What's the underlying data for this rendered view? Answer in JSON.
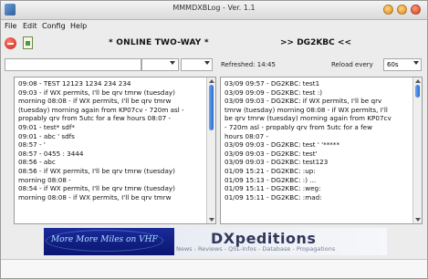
{
  "window": {
    "title": "MMMDXBLog - Ver. 1.1"
  },
  "menu": {
    "items": [
      "File",
      "Edit",
      "Config",
      "Help"
    ]
  },
  "toolbar": {
    "status": "* ONLINE  TWO-WAY *",
    "target": ">> DG2KBC <<"
  },
  "filter": {
    "refreshed": "Refreshed: 14:45",
    "reload_label": "Reload every",
    "reload_value": "60s"
  },
  "left_log": {
    "lines": [
      "09:08 - TEST 12123 1234 234 234",
      "09:03 - if WX permits, I'll be qrv tmrw (tuesday)",
      "morning 08:08 - if WX permits, I'll be qrv tmrw",
      "(tuesday) morning again from KP07cv - 720m asl -",
      "propably qrv from 5utc for a few hours 08:07 -",
      "09:01 - test* sdf*",
      "09:01 - abc ' sdfs",
      "08:57 - '",
      "08:57 - 0455 : 3444",
      "08:56 - abc",
      "08:56 - if WX permits, I'll be qrv tmrw (tuesday)",
      "morning 08:08 -",
      "08:54 - if WX permits, I'll be qrv tmrw (tuesday)",
      "morning 08:08 - if WX permits, I'll be qrv tmrw"
    ]
  },
  "right_log": {
    "lines": [
      "03/09  09:57 - DG2KBC: test1",
      "03/09  09:09 - DG2KBC: test :)",
      "03/09  09:03 - DG2KBC: if WX permits, I'll be qrv",
      "tmrw (tuesday) morning 08:08 - if WX permits, I'll",
      "be qrv tmrw (tuesday) morning again from KP07cv",
      "- 720m asl - propably qrv from 5utc for a few",
      "hours 08:07 -",
      "03/09  09:03 - DG2KBC: test ' '*****",
      "03/09  09:03 - DG2KBC: test'",
      "03/09  09:03 - DG2KBC: test123",
      "01/09  15:21 - DG2KBC: :up:",
      "01/09  15:13 - DG2KBC: :) ...",
      "01/09  15:11 - DG2KBC: :weg:",
      "01/09  15:11 - DG2KBC: :mad:"
    ]
  },
  "banner": {
    "left_text": "More More Miles on VHF",
    "right_title": "DXpeditions",
    "right_sub": "News - Reviews - QSL-Infos - Database - Propagations"
  },
  "icons": [
    "app-icon",
    "stop-icon",
    "document-icon",
    "chevron-down-icon"
  ]
}
